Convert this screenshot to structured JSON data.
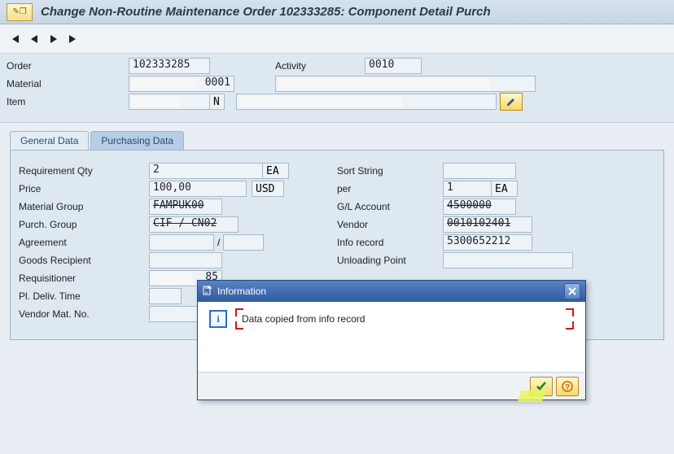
{
  "title": "Change Non-Routine Maintenance Order 102333285: Component Detail Purch",
  "header": {
    "order_label": "Order",
    "order_value": "102333285",
    "activity_label": "Activity",
    "activity_value": "0010",
    "material_label": "Material",
    "material_value": "0001",
    "item_label": "Item",
    "item_indicator": "N"
  },
  "tabs": {
    "general": "General Data",
    "purchasing": "Purchasing Data"
  },
  "left": {
    "req_qty_label": "Requirement Qty",
    "req_qty_value": "2",
    "req_qty_unit": "EA",
    "price_label": "Price",
    "price_value": "100,00",
    "price_unit": "USD",
    "matgrp_label": "Material Group",
    "matgrp_value": "FAMPUK00",
    "purchgrp_label": "Purch. Group",
    "purchgrp_value": "CIF / CN02",
    "agreement_label": "Agreement",
    "agreement_sep": "/",
    "goods_label": "Goods Recipient",
    "requisitioner_label": "Requisitioner",
    "requisitioner_value": "85",
    "deliv_label": "Pl. Deliv. Time",
    "vendormat_label": "Vendor Mat. No."
  },
  "right": {
    "sort_label": "Sort String",
    "per_label": "per",
    "per_value": "1",
    "per_unit": "EA",
    "gl_label": "G/L Account",
    "gl_value": "4500000",
    "vendor_label": "Vendor",
    "vendor_value": "0010102401",
    "info_label": "Info record",
    "info_value": "5300652212",
    "unload_label": "Unloading Point"
  },
  "modal": {
    "title": "Information",
    "message": "Data copied from info record"
  }
}
